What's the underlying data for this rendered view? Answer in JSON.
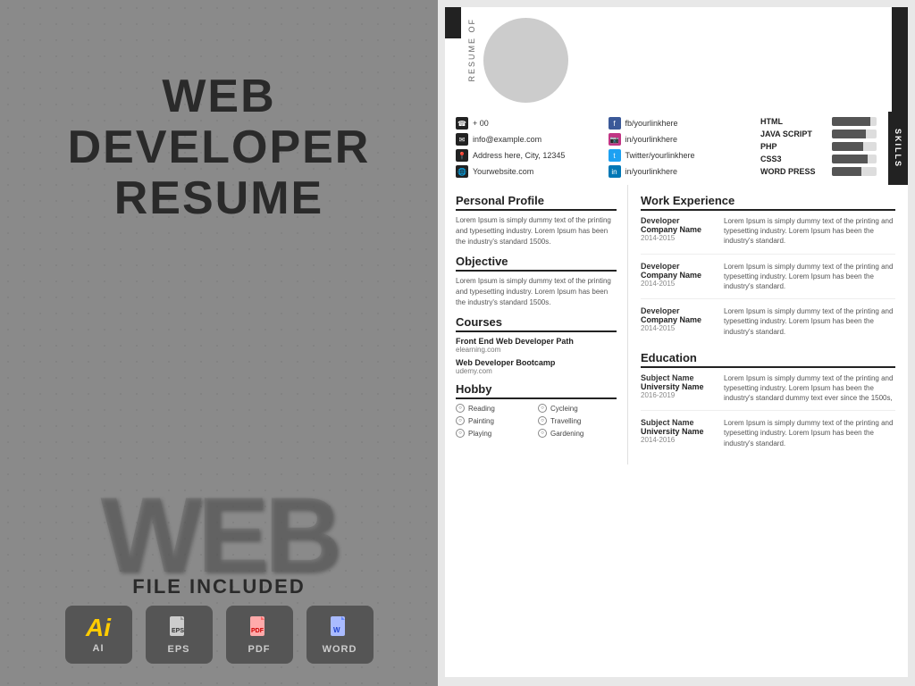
{
  "left": {
    "title_line1": "WEB",
    "title_line2": "DEVELOPER",
    "title_line3": "RESUME",
    "watermark": "WEB",
    "file_included_label": "FILE INCLUDED",
    "file_icons": [
      {
        "id": "ai",
        "symbol": "Ai",
        "label": "AI",
        "type": "ai"
      },
      {
        "id": "eps",
        "symbol": "EPS",
        "label": "EPS",
        "type": "eps"
      },
      {
        "id": "pdf",
        "symbol": "PDF",
        "label": "PDF",
        "type": "pdf"
      },
      {
        "id": "word",
        "symbol": "W",
        "label": "WORD",
        "type": "word"
      }
    ]
  },
  "resume": {
    "resume_of_label": "Resume Of",
    "contact": {
      "phone": "+ 00",
      "email": "info@example.com",
      "address": "Address here, City, 12345",
      "website": "Yourwebsite.com",
      "social1": "fb/yourlinkhere",
      "social2": "in/yourlinkhere",
      "social3": "Twitter/yourlinkhere",
      "social4": "in/yourlinkhere"
    },
    "skills": {
      "label": "SKILLS",
      "items": [
        {
          "name": "HTML",
          "percent": 85
        },
        {
          "name": "JAVA SCRIPT",
          "percent": 75
        },
        {
          "name": "PHP",
          "percent": 70
        },
        {
          "name": "CSS3",
          "percent": 80
        },
        {
          "name": "WORD PRESS",
          "percent": 65
        }
      ]
    },
    "personal_profile": {
      "title": "Personal Profile",
      "text": "Lorem Ipsum is simply dummy text of the printing and typesetting industry. Lorem Ipsum has been the industry's standard 1500s."
    },
    "objective": {
      "title": "Objective",
      "text": "Lorem Ipsum is simply dummy text of the printing and typesetting industry. Lorem Ipsum has been the industry's standard 1500s."
    },
    "courses": {
      "title": "Courses",
      "items": [
        {
          "name": "Front End Web Developer Path",
          "site": "elearning.com"
        },
        {
          "name": "Web Developer Bootcamp",
          "site": "udemy.com"
        }
      ]
    },
    "hobby": {
      "title": "Hobby",
      "items": [
        {
          "name": "Reading"
        },
        {
          "name": "Cycleing"
        },
        {
          "name": "Painting"
        },
        {
          "name": "Travelling"
        },
        {
          "name": "Playing"
        },
        {
          "name": "Gardening"
        }
      ]
    },
    "work_experience": {
      "title": "Work Experience",
      "entries": [
        {
          "role": "Developer",
          "company": "Company Name",
          "date": "2014-2015",
          "desc": "Lorem Ipsum is simply dummy text of the printing and typesetting industry. Lorem Ipsum has been the industry's standard."
        },
        {
          "role": "Developer",
          "company": "Company Name",
          "date": "2014-2015",
          "desc": "Lorem Ipsum is simply dummy text of the printing and typesetting industry. Lorem Ipsum has been the industry's standard."
        },
        {
          "role": "Developer",
          "company": "Company Name",
          "date": "2014-2015",
          "desc": "Lorem Ipsum is simply dummy text of the printing and typesetting industry. Lorem Ipsum has been the industry's standard."
        }
      ]
    },
    "education": {
      "title": "Education",
      "entries": [
        {
          "subject": "Subject Name",
          "university": "University Name",
          "date": "2016-2019",
          "desc": "Lorem Ipsum is simply dummy text of the printing and typesetting industry. Lorem Ipsum has been the industry's standard dummy text ever since the 1500s,"
        },
        {
          "subject": "Subject Name",
          "university": "University Name",
          "date": "2014-2016",
          "desc": "Lorem Ipsum is simply dummy text of the printing and typesetting industry. Lorem Ipsum has been the industry's standard."
        }
      ]
    }
  }
}
